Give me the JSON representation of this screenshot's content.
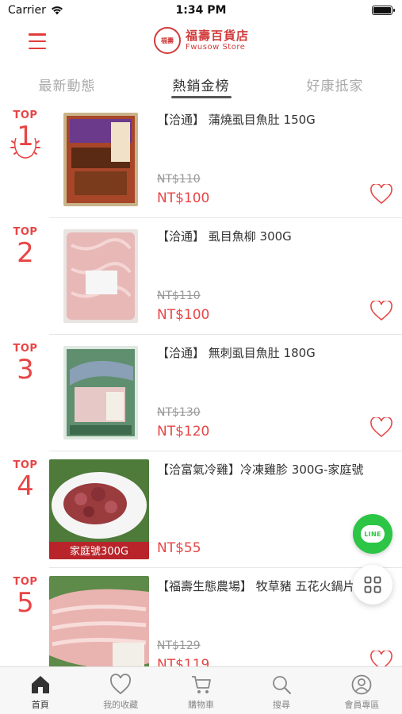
{
  "status_bar": {
    "carrier": "Carrier",
    "time": "1:34 PM"
  },
  "header": {
    "logo_cn": "福壽百貨店",
    "logo_en": "Fwusow Store",
    "logo_seal": "福壽"
  },
  "tabs": [
    {
      "label": "最新動態",
      "active": false
    },
    {
      "label": "熱銷金榜",
      "active": true
    },
    {
      "label": "好康抵家",
      "active": false
    }
  ],
  "rank_prefix": "TOP",
  "products": [
    {
      "rank": "1",
      "title": "【洽通】 蒲燒虱目魚肚 150G",
      "old_price": "NT$110",
      "price": "NT$100",
      "favorite": false
    },
    {
      "rank": "2",
      "title": "【洽通】 虱目魚柳 300G",
      "old_price": "NT$110",
      "price": "NT$100",
      "favorite": false
    },
    {
      "rank": "3",
      "title": "【洽通】 無刺虱目魚肚 180G",
      "old_price": "NT$130",
      "price": "NT$120",
      "favorite": false
    },
    {
      "rank": "4",
      "title": "【洽富氣冷雞】冷凍雞胗 300G-家庭號",
      "old_price": "",
      "price": "NT$55",
      "image_caption": "家庭號300G",
      "favorite": false
    },
    {
      "rank": "5",
      "title": "【福壽生態農場】 牧草豬 五花火鍋片 250G",
      "old_price": "NT$129",
      "price": "NT$119",
      "favorite": false
    }
  ],
  "fab": {
    "line_label": "LINE"
  },
  "tabbar": [
    {
      "label": "首頁",
      "icon": "home-icon",
      "active": true
    },
    {
      "label": "我的收藏",
      "icon": "heart-icon",
      "active": false
    },
    {
      "label": "購物車",
      "icon": "cart-icon",
      "active": false
    },
    {
      "label": "搜尋",
      "icon": "search-icon",
      "active": false
    },
    {
      "label": "會員專區",
      "icon": "user-icon",
      "active": false
    }
  ],
  "colors": {
    "accent": "#e84545",
    "line_green": "#2cc545",
    "brand": "#d23a3a"
  }
}
